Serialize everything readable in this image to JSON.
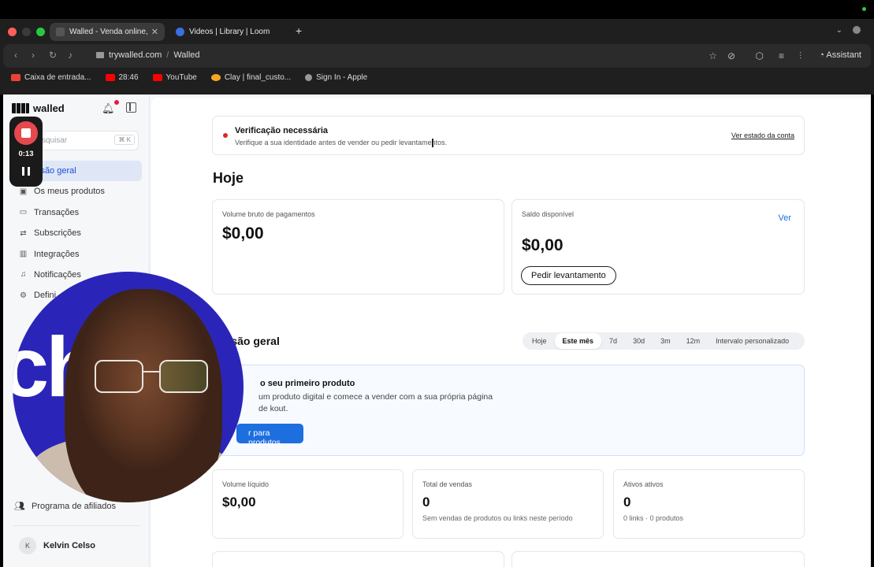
{
  "browser": {
    "tabs": [
      {
        "title": "Walled - Venda online, re",
        "favicon_color": "#3a3a3a",
        "active": true
      },
      {
        "title": "Videos | Library | Loom",
        "favicon_color": "#3b6fe0",
        "active": false
      }
    ],
    "url": {
      "domain": "trywalled.com",
      "separator": "/",
      "page": "Walled"
    },
    "assistant_label": "Assistant",
    "bookmarks": [
      {
        "label": "Caixa de entrada...",
        "color": "#ea4335"
      },
      {
        "label": "28:46",
        "color": "#ff0000"
      },
      {
        "label": "YouTube",
        "color": "#ff0000"
      },
      {
        "label": "Clay | final_custo...",
        "color": "#f5a623"
      },
      {
        "label": "Sign In - Apple",
        "color": "#999999"
      }
    ]
  },
  "sidebar": {
    "brand": "walled",
    "search": {
      "placeholder": "squisar",
      "shortcut": "⌘ K"
    },
    "items": [
      {
        "label": "isão geral",
        "icon": "home-icon",
        "active": true
      },
      {
        "label": "Os meus produtos",
        "icon": "box-icon"
      },
      {
        "label": "Transações",
        "icon": "card-icon"
      },
      {
        "label": "Subscrições",
        "icon": "repeat-icon"
      },
      {
        "label": "Integrações",
        "icon": "chart-icon"
      },
      {
        "label": "Notificações",
        "icon": "bell-icon"
      },
      {
        "label": "Defini",
        "icon": "gear-icon"
      }
    ],
    "affiliate": "Programa de afiliados",
    "user": {
      "initial": "K",
      "name": "Kelvin Celso"
    }
  },
  "main": {
    "verification": {
      "title": "Verificação necessária",
      "description": "Verifique a sua identidade antes de vender ou pedir levantamentos.",
      "link": "Ver estado da conta"
    },
    "today_heading": "Hoje",
    "gross_volume": {
      "label": "Volume bruto de pagamentos",
      "value": "$0,00"
    },
    "balance": {
      "label": "Saldo disponível",
      "value": "$0,00",
      "view_link": "Ver",
      "withdraw_button": "Pedir levantamento"
    },
    "overview_heading": "a visão geral",
    "ranges": [
      "Hoje",
      "Este mês",
      "7d",
      "30d",
      "3m",
      "12m",
      "Intervalo personalizado"
    ],
    "selected_range": "Este mês",
    "promo": {
      "title": "o seu primeiro produto",
      "description": "um produto digital e comece a vender com a sua própria página de kout.",
      "button": "r para produtos"
    },
    "stats": [
      {
        "label": "Volume líquido",
        "value": "$0,00",
        "sub": ""
      },
      {
        "label": "Total de vendas",
        "value": "0",
        "sub": "Sem vendas de produtos ou links neste período"
      },
      {
        "label": "Ativos ativos",
        "value": "0",
        "sub": "0 links · 0 produtos"
      }
    ]
  },
  "recorder": {
    "time": "0:13"
  }
}
